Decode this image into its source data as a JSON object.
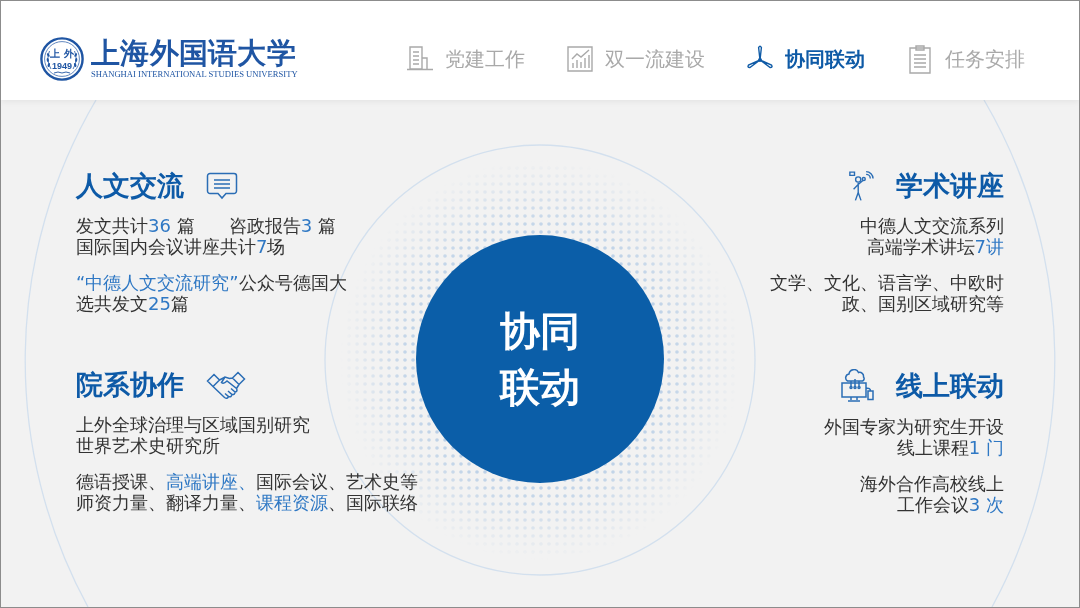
{
  "logo": {
    "seal_text": "上 外",
    "seal_year": "1949",
    "name": "上海外国语大学",
    "english": "SHANGHAI INTERNATIONAL STUDIES UNIVERSITY"
  },
  "tabs": [
    {
      "label": "党建工作",
      "kind": "document",
      "selected": false
    },
    {
      "label": "双一流建设",
      "kind": "chart",
      "selected": false
    },
    {
      "label": "协同联动",
      "kind": "windmill",
      "selected": true
    },
    {
      "label": "任务安排",
      "kind": "clipboard",
      "selected": false
    }
  ],
  "center": {
    "lines": [
      "协同",
      "联动"
    ]
  },
  "rows": [
    {
      "left": {
        "heading": "人文交流",
        "kind": "chat",
        "paragraphs": [
          {
            "lines": [
              [
                {
                  "segments": [
                    {
                      "text": "发文共计",
                      "highlight": false
                    },
                    {
                      "text": "36",
                      "highlight": true
                    },
                    {
                      "text": " 篇",
                      "highlight": false
                    }
                  ]
                },
                {
                  "segments": [
                    {
                      "text": "咨政报告",
                      "highlight": false
                    },
                    {
                      "text": "3",
                      "highlight": true
                    },
                    {
                      "text": " 篇",
                      "highlight": false
                    }
                  ]
                }
              ],
              [
                {
                  "segments": [
                    {
                      "text": "国际国内会议讲座共计",
                      "highlight": false
                    },
                    {
                      "text": "7",
                      "highlight": true
                    },
                    {
                      "text": "场",
                      "highlight": false
                    }
                  ]
                }
              ]
            ]
          },
          {
            "lines": [
              [
                {
                  "segments": [
                    {
                      "text": "“中德人文交流研究”",
                      "highlight": true
                    },
                    {
                      "text": "公众号德国大",
                      "highlight": false
                    }
                  ]
                }
              ],
              [
                {
                  "segments": [
                    {
                      "text": "选共发文",
                      "highlight": false
                    },
                    {
                      "text": "25",
                      "highlight": true
                    },
                    {
                      "text": "篇",
                      "highlight": false
                    }
                  ]
                }
              ]
            ]
          }
        ]
      },
      "right": {
        "heading": "学术讲座",
        "kind": "lecturer",
        "paragraphs": [
          {
            "lines": [
              [
                {
                  "segments": [
                    {
                      "text": "中德人文交流系列",
                      "highlight": false
                    }
                  ]
                }
              ],
              [
                {
                  "segments": [
                    {
                      "text": "高端学术讲坛",
                      "highlight": false
                    },
                    {
                      "text": "7讲",
                      "highlight": true
                    }
                  ]
                }
              ]
            ]
          },
          {
            "lines": [
              [
                {
                  "segments": [
                    {
                      "text": "文学、文化、语言学、中欧时",
                      "highlight": false
                    }
                  ]
                }
              ],
              [
                {
                  "segments": [
                    {
                      "text": "政、国别区域研究等",
                      "highlight": false
                    }
                  ]
                }
              ]
            ]
          }
        ]
      }
    },
    {
      "left": {
        "heading": "院系协作",
        "kind": "handshake",
        "paragraphs": [
          {
            "lines": [
              [
                {
                  "segments": [
                    {
                      "text": "上外全球治理与区域国别研究",
                      "highlight": false
                    }
                  ]
                }
              ],
              [
                {
                  "segments": [
                    {
                      "text": "世界艺术史研究所",
                      "highlight": false
                    }
                  ]
                }
              ]
            ]
          },
          {
            "lines": [
              [
                {
                  "segments": [
                    {
                      "text": "德语授课、",
                      "highlight": false
                    },
                    {
                      "text": "高端讲座、",
                      "highlight": true
                    },
                    {
                      "text": "国际会议、艺术史等",
                      "highlight": false
                    }
                  ]
                }
              ],
              [
                {
                  "segments": [
                    {
                      "text": "师资力量、翻译力量、",
                      "highlight": false
                    },
                    {
                      "text": "课程资源",
                      "highlight": true
                    },
                    {
                      "text": "、国际联络",
                      "highlight": false
                    }
                  ]
                }
              ]
            ]
          }
        ]
      },
      "right": {
        "heading": "线上联动",
        "kind": "online",
        "paragraphs": [
          {
            "lines": [
              [
                {
                  "segments": [
                    {
                      "text": "外国专家为研究生开设",
                      "highlight": false
                    }
                  ]
                }
              ],
              [
                {
                  "segments": [
                    {
                      "text": "线上课程",
                      "highlight": false
                    },
                    {
                      "text": "1 门",
                      "highlight": true
                    }
                  ]
                }
              ]
            ]
          },
          {
            "lines": [
              [
                {
                  "segments": [
                    {
                      "text": "海外合作高校线上",
                      "highlight": false
                    }
                  ]
                }
              ],
              [
                {
                  "segments": [
                    {
                      "text": "工作会议",
                      "highlight": false
                    },
                    {
                      "text": "3 次",
                      "highlight": true
                    }
                  ]
                }
              ]
            ]
          }
        ]
      }
    }
  ]
}
